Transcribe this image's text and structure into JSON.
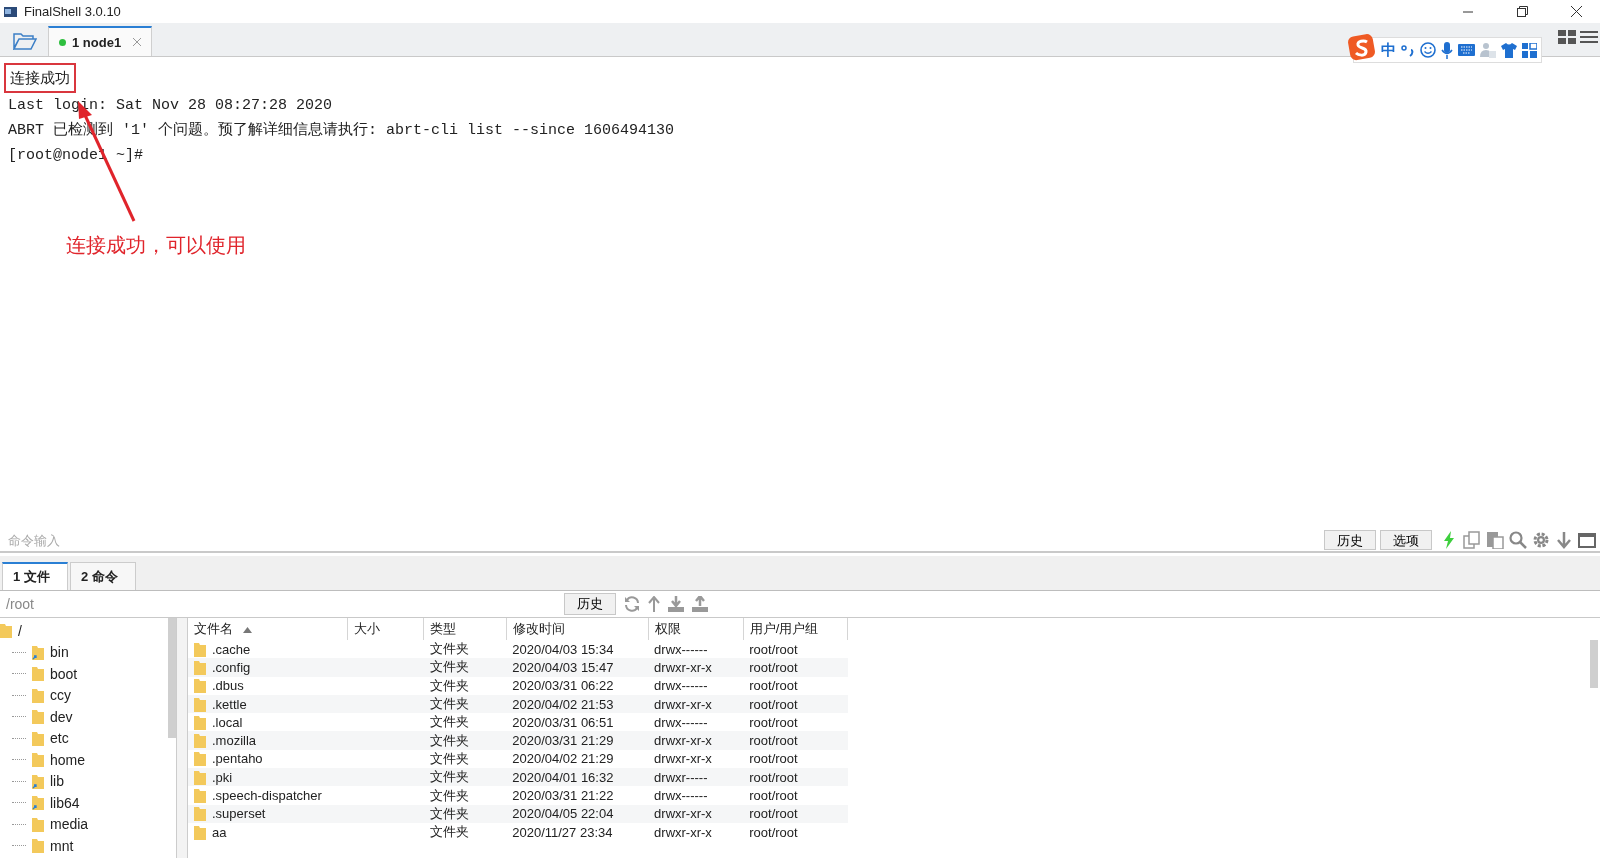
{
  "window": {
    "title": "FinalShell 3.0.10"
  },
  "session_tabs": [
    {
      "label": "1 node1",
      "connected": true,
      "selected": true
    }
  ],
  "ime_toolbar": {
    "mode": "中"
  },
  "terminal": {
    "lines": [
      {
        "text": "连接成功",
        "boxed": true
      },
      {
        "text": "Last login: Sat Nov 28 08:27:28 2020",
        "boxed": false
      },
      {
        "text": "ABRT 已检测到 '1' 个问题。预了解详细信息请执行: abrt-cli list --since 1606494130",
        "boxed": false
      },
      {
        "text": "[root@node1 ~]#",
        "boxed": false
      }
    ]
  },
  "annotation": {
    "text": "连接成功，可以使用"
  },
  "command_input": {
    "placeholder": "命令输入",
    "buttons": [
      "历史",
      "选项"
    ]
  },
  "bottom_tabs": [
    {
      "label": "1 文件",
      "selected": true
    },
    {
      "label": "2 命令",
      "selected": false
    }
  ],
  "path_bar": {
    "path": "/root",
    "history_button": "历史"
  },
  "tree": {
    "label": "/",
    "children": [
      {
        "label": "bin",
        "link": true
      },
      {
        "label": "boot",
        "link": false
      },
      {
        "label": "ccy",
        "link": false
      },
      {
        "label": "dev",
        "link": false
      },
      {
        "label": "etc",
        "link": false
      },
      {
        "label": "home",
        "link": false
      },
      {
        "label": "lib",
        "link": true
      },
      {
        "label": "lib64",
        "link": true
      },
      {
        "label": "media",
        "link": false
      },
      {
        "label": "mnt",
        "link": false
      }
    ]
  },
  "table": {
    "columns": [
      {
        "label": "文件名",
        "sorted": true
      },
      {
        "label": "大小",
        "sorted": false
      },
      {
        "label": "类型",
        "sorted": false
      },
      {
        "label": "修改时间",
        "sorted": false
      },
      {
        "label": "权限",
        "sorted": false
      },
      {
        "label": "用户/用户组",
        "sorted": false
      }
    ],
    "rows": [
      {
        "name": ".cache",
        "size": "",
        "type": "文件夹",
        "modified": "2020/04/03 15:34",
        "permissions": "drwx------",
        "owner": "root/root"
      },
      {
        "name": ".config",
        "size": "",
        "type": "文件夹",
        "modified": "2020/04/03 15:47",
        "permissions": "drwxr-xr-x",
        "owner": "root/root"
      },
      {
        "name": ".dbus",
        "size": "",
        "type": "文件夹",
        "modified": "2020/03/31 06:22",
        "permissions": "drwx------",
        "owner": "root/root"
      },
      {
        "name": ".kettle",
        "size": "",
        "type": "文件夹",
        "modified": "2020/04/02 21:53",
        "permissions": "drwxr-xr-x",
        "owner": "root/root"
      },
      {
        "name": ".local",
        "size": "",
        "type": "文件夹",
        "modified": "2020/03/31 06:51",
        "permissions": "drwx------",
        "owner": "root/root"
      },
      {
        "name": ".mozilla",
        "size": "",
        "type": "文件夹",
        "modified": "2020/03/31 21:29",
        "permissions": "drwxr-xr-x",
        "owner": "root/root"
      },
      {
        "name": ".pentaho",
        "size": "",
        "type": "文件夹",
        "modified": "2020/04/02 21:29",
        "permissions": "drwxr-xr-x",
        "owner": "root/root"
      },
      {
        "name": ".pki",
        "size": "",
        "type": "文件夹",
        "modified": "2020/04/01 16:32",
        "permissions": "drwxr-----",
        "owner": "root/root"
      },
      {
        "name": ".speech-dispatcher",
        "size": "",
        "type": "文件夹",
        "modified": "2020/03/31 21:22",
        "permissions": "drwx------",
        "owner": "root/root"
      },
      {
        "name": ".superset",
        "size": "",
        "type": "文件夹",
        "modified": "2020/04/05 22:04",
        "permissions": "drwxr-xr-x",
        "owner": "root/root"
      },
      {
        "name": "aa",
        "size": "",
        "type": "文件夹",
        "modified": "2020/11/27 23:34",
        "permissions": "drwxr-xr-x",
        "owner": "root/root"
      }
    ]
  }
}
